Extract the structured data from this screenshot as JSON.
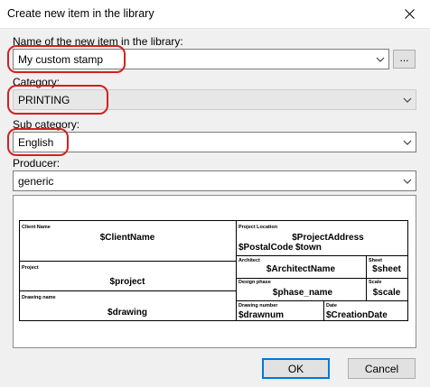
{
  "window": {
    "title": "Create new item in the library"
  },
  "fields": {
    "name_label": "Name of the new item in the library:",
    "name_value": "My custom stamp",
    "browse_label": "...",
    "category_label": "Category:",
    "category_value": "PRINTING",
    "subcategory_label": "Sub category:",
    "subcategory_value": "English",
    "producer_label": "Producer:",
    "producer_value": "generic"
  },
  "stamp": {
    "client_name_label": "Client Name",
    "client_name_value": "$ClientName",
    "project_location_label": "Project Location",
    "project_address_value": "$ProjectAddress",
    "postal_code_value": "$PostalCode",
    "town_value": "$town",
    "project_label": "Project",
    "project_value": "$project",
    "architect_label": "Architect",
    "architect_value": "$ArchitectName",
    "sheet_label": "Sheet",
    "sheet_value": "$sheet",
    "design_phase_label": "Design phase",
    "phase_value": "$phase_name",
    "scale_label": "Scale",
    "scale_value": "$scale",
    "drawing_name_label": "Drawing name",
    "drawing_value": "$drawing",
    "drawing_number_label": "Drawing number",
    "drawnum_value": "$drawnum",
    "date_label": "Date",
    "date_value": "$CreationDate"
  },
  "buttons": {
    "ok_label": "OK",
    "cancel_label": "Cancel"
  },
  "colors": {
    "highlight": "#d42020",
    "default_button_border": "#0078d7"
  }
}
